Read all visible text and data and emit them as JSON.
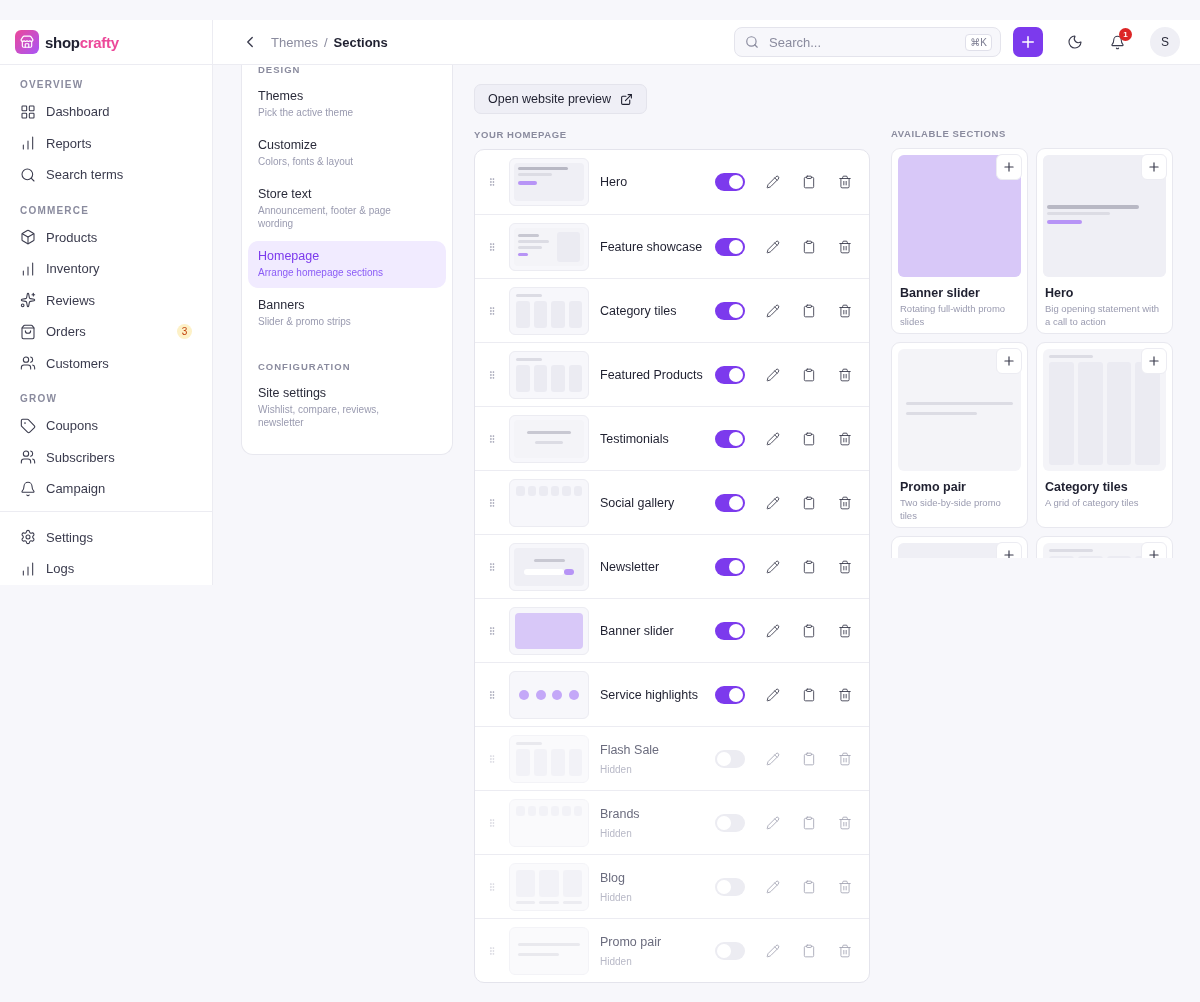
{
  "brand": {
    "name_start": "shop",
    "name_end": "crafty"
  },
  "sidebar": {
    "sections": [
      {
        "label": "OVERVIEW",
        "items": [
          {
            "label": "Dashboard",
            "selected": false
          },
          {
            "label": "Reports",
            "selected": false
          },
          {
            "label": "Search terms",
            "selected": false
          }
        ]
      },
      {
        "label": "COMMERCE",
        "items": [
          {
            "label": "Products",
            "selected": false
          },
          {
            "label": "Inventory",
            "selected": false
          },
          {
            "label": "Reviews",
            "selected": false
          },
          {
            "label": "Orders",
            "selected": false,
            "badge": "3"
          },
          {
            "label": "Customers",
            "selected": false
          }
        ]
      },
      {
        "label": "GROW",
        "items": [
          {
            "label": "Coupons",
            "selected": false
          },
          {
            "label": "Subscribers",
            "selected": false
          },
          {
            "label": "Campaign",
            "selected": false
          }
        ]
      }
    ],
    "footer_items": [
      {
        "label": "Settings",
        "selected": false
      },
      {
        "label": "Logs",
        "selected": false
      }
    ]
  },
  "header": {
    "breadcrumb": [
      "Themes",
      "Sections"
    ],
    "breadcrumb_separator": "/",
    "search": {
      "placeholder": "Search...",
      "shortcut": "⌘K"
    },
    "notifications": "1",
    "avatar": "S"
  },
  "subnav": {
    "groups": [
      {
        "label": "DESIGN",
        "items": [
          {
            "title": "Themes",
            "subtitle": "Pick the active theme",
            "selected": false
          },
          {
            "title": "Customize",
            "subtitle": "Colors, fonts & layout",
            "selected": false
          },
          {
            "title": "Store text",
            "subtitle": "Announcement, footer & page wording",
            "selected": false
          },
          {
            "title": "Homepage",
            "subtitle": "Arrange homepage sections",
            "selected": true
          },
          {
            "title": "Banners",
            "subtitle": "Slider & promo strips",
            "selected": false
          }
        ]
      },
      {
        "label": "CONFIGURATION",
        "items": [
          {
            "title": "Site settings",
            "subtitle": "Wishlist, compare, reviews, newsletter",
            "selected": false
          }
        ]
      }
    ]
  },
  "preview_button": "Open website preview",
  "homepage": {
    "label": "YOUR HOMEPAGE",
    "sections": [
      {
        "name": "Hero",
        "kind": "hero",
        "on": true
      },
      {
        "name": "Feature showcase",
        "kind": "showcase",
        "on": true
      },
      {
        "name": "Category tiles",
        "kind": "tiles",
        "on": true
      },
      {
        "name": "Featured Products",
        "kind": "tiles",
        "on": true
      },
      {
        "name": "Testimonials",
        "kind": "quote",
        "on": true
      },
      {
        "name": "Social gallery",
        "kind": "gallery",
        "on": true
      },
      {
        "name": "Newsletter",
        "kind": "newsletter",
        "on": true
      },
      {
        "name": "Banner slider",
        "kind": "banner",
        "on": true
      },
      {
        "name": "Service highlights",
        "kind": "dots",
        "on": true
      },
      {
        "name": "Flash Sale",
        "kind": "tiles",
        "on": false,
        "status": "Hidden"
      },
      {
        "name": "Brands",
        "kind": "gallery",
        "on": false,
        "status": "Hidden"
      },
      {
        "name": "Blog",
        "kind": "blog",
        "on": false,
        "status": "Hidden"
      },
      {
        "name": "Promo pair",
        "kind": "promo",
        "on": false,
        "status": "Hidden"
      }
    ]
  },
  "available": {
    "label": "AVAILABLE SECTIONS",
    "cards": [
      {
        "title": "Banner slider",
        "description": "Rotating full-width promo slides",
        "kind": "banner"
      },
      {
        "title": "Hero",
        "description": "Big opening statement with a call to action",
        "kind": "hero"
      },
      {
        "title": "Promo pair",
        "description": "Two side-by-side promo tiles",
        "kind": "promo"
      },
      {
        "title": "Category tiles",
        "description": "A grid of category tiles",
        "kind": "tiles"
      },
      {
        "kind": "blank"
      },
      {
        "kind": "tiles"
      }
    ]
  }
}
